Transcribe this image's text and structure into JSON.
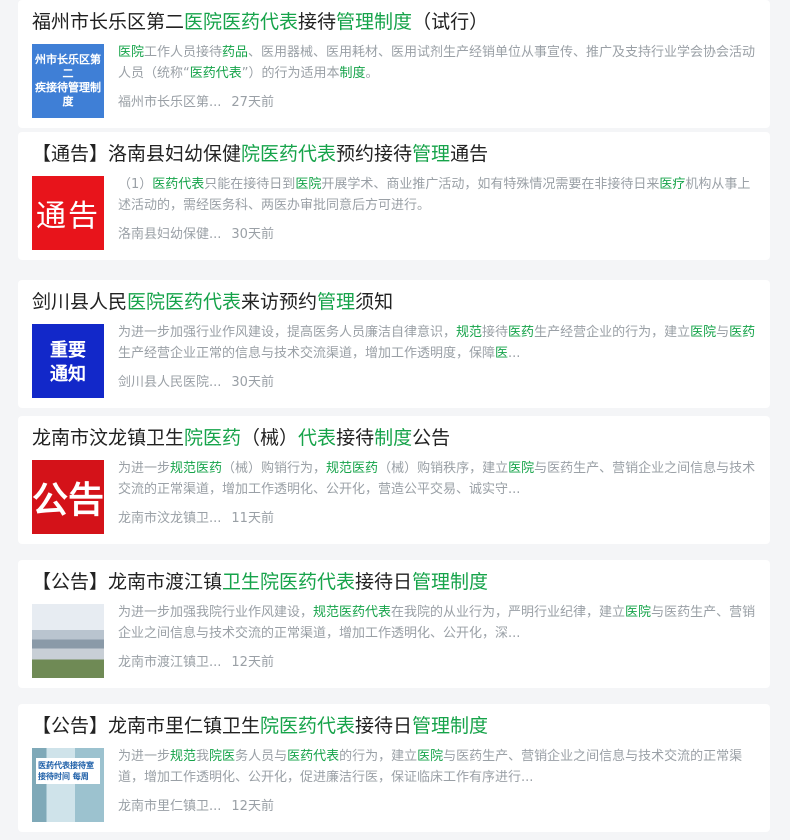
{
  "results": [
    {
      "title_parts": [
        "福州市长乐区第二",
        "医院医药代表",
        "接待",
        "管理制度",
        "（试行）"
      ],
      "title_hl": [
        false,
        true,
        false,
        true,
        false
      ],
      "thumb": {
        "style": "blue",
        "text": "州市长乐区第二\n疾接待管理制度"
      },
      "snippet_parts": [
        "医院",
        "工作人员接待",
        "药品",
        "、医用器械、医用耗材、医用试剂生产经销单位从事宣传、推广及支持行业学会协会活动人员（统称“",
        "医药代表",
        "”）的行为适用本",
        "制度",
        "。"
      ],
      "snippet_hl": [
        true,
        false,
        true,
        false,
        true,
        false,
        true,
        false
      ],
      "source": "福州市长乐区第...",
      "time": "27天前"
    },
    {
      "title_parts": [
        "【通告】洛南县妇幼保健",
        "院医药代表",
        "预约接待",
        "管理",
        "通告"
      ],
      "title_hl": [
        false,
        true,
        false,
        true,
        false
      ],
      "thumb": {
        "style": "red",
        "text": "通告"
      },
      "snippet_parts": [
        "（1）",
        "医药代表",
        "只能在接待日到",
        "医院",
        "开展学术、商业推广活动，如有特殊情况需要在非接待日来",
        "医疗",
        "机构从事上述活动的，需经医务科、两医办审批同意后方可进行。"
      ],
      "snippet_hl": [
        false,
        true,
        false,
        true,
        false,
        true,
        false
      ],
      "source": "洛南县妇幼保健...",
      "time": "30天前"
    },
    {
      "title_parts": [
        "剑川县人民",
        "医院医药代表",
        "来访预约",
        "管理",
        "须知"
      ],
      "title_hl": [
        false,
        true,
        false,
        true,
        false
      ],
      "thumb": {
        "style": "navy",
        "text": "重要\n通知"
      },
      "snippet_parts": [
        "为进一步加强行业作风建设，提高医务人员廉洁自律意识，",
        "规范",
        "接待",
        "医药",
        "生产经营企业的行为，建立",
        "医院",
        "与",
        "医药",
        "生产经营企业正常的信息与技术交流渠道，增加工作透明度，保障",
        "医",
        "..."
      ],
      "snippet_hl": [
        false,
        true,
        false,
        true,
        false,
        true,
        false,
        true,
        false,
        true,
        false
      ],
      "source": "剑川县人民医院...",
      "time": "30天前"
    },
    {
      "title_parts": [
        "龙南市汶龙镇卫生",
        "院医药",
        "（械）",
        "代表",
        "接待",
        "制度",
        "公告"
      ],
      "title_hl": [
        false,
        true,
        false,
        true,
        false,
        true,
        false
      ],
      "thumb": {
        "style": "red2",
        "text": "公告"
      },
      "snippet_parts": [
        "为进一步",
        "规范医药",
        "（械）购销行为，",
        "规范医药",
        "（械）购销秩序，建立",
        "医院",
        "与医药生产、营销企业之间信息与技术交流的正常渠道，增加工作透明化、公开化，营造公平交易、诚实守..."
      ],
      "snippet_hl": [
        false,
        true,
        false,
        true,
        false,
        true,
        false
      ],
      "source": "龙南市汶龙镇卫...",
      "time": "11天前"
    },
    {
      "title_parts": [
        "【公告】龙南市渡江镇",
        "卫生院医药代表",
        "接待日",
        "管理制度"
      ],
      "title_hl": [
        false,
        true,
        false,
        true
      ],
      "thumb": {
        "style": "photo1",
        "text": ""
      },
      "snippet_parts": [
        "为进一步加强我院行业作风建设，",
        "规范医药代表",
        "在我院的从业行为，严明行业纪律，建立",
        "医院",
        "与医药生产、营销企业之间信息与技术交流的正常渠道，增加工作透明化、公开化，深..."
      ],
      "snippet_hl": [
        false,
        true,
        false,
        true,
        false
      ],
      "source": "龙南市渡江镇卫...",
      "time": "12天前"
    },
    {
      "title_parts": [
        "【公告】龙南市里仁镇卫生",
        "院医药代表",
        "接待日",
        "管理制度"
      ],
      "title_hl": [
        false,
        true,
        false,
        true
      ],
      "thumb": {
        "style": "photo2",
        "text": "医药代表接待室\n接待时间 每周"
      },
      "snippet_parts": [
        "为进一步",
        "规范",
        "我",
        "院医",
        "务人员与",
        "医药代表",
        "的行为，建立",
        "医院",
        "与医药生产、营销企业之间信息与技术交流的正常渠道，增加工作透明化、公开化，促进廉洁行医，保证临床工作有序进行..."
      ],
      "snippet_hl": [
        false,
        true,
        false,
        true,
        false,
        true,
        false,
        true,
        false
      ],
      "source": "龙南市里仁镇卫...",
      "time": "12天前"
    }
  ]
}
